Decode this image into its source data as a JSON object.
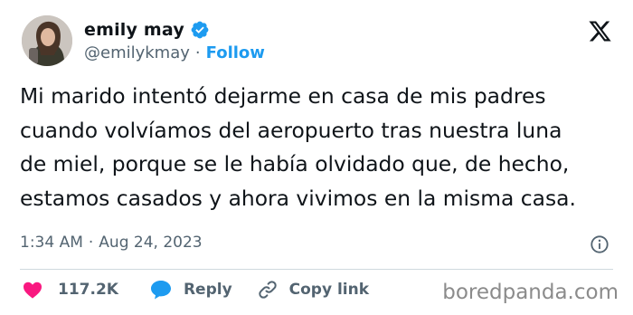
{
  "author": {
    "display_name": "emily may",
    "handle": "@emilykmay",
    "follow_label": "Follow",
    "separator": "·"
  },
  "tweet": {
    "lines": [
      "Mi marido intentó dejarme en casa de mis padres",
      "cuando volvíamos del aeropuerto tras nuestra luna",
      "de miel, porque se le había olvidado que, de hecho,",
      "estamos casados y ahora vivimos en la misma casa."
    ]
  },
  "meta": {
    "time": "1:34 AM",
    "separator": "·",
    "date": "Aug 24, 2023"
  },
  "actions": {
    "likes_count": "117.2K",
    "reply_label": "Reply",
    "copy_link_label": "Copy link"
  },
  "watermark": "boredpanda.com",
  "colors": {
    "accent": "#1d9bf0",
    "like": "#f91880",
    "text": "#0f1419",
    "secondary": "#536471",
    "divider": "#cfd9de"
  },
  "icons": [
    "verified-badge-icon",
    "x-logo-icon",
    "info-icon",
    "heart-icon",
    "reply-bubble-icon",
    "link-icon"
  ]
}
